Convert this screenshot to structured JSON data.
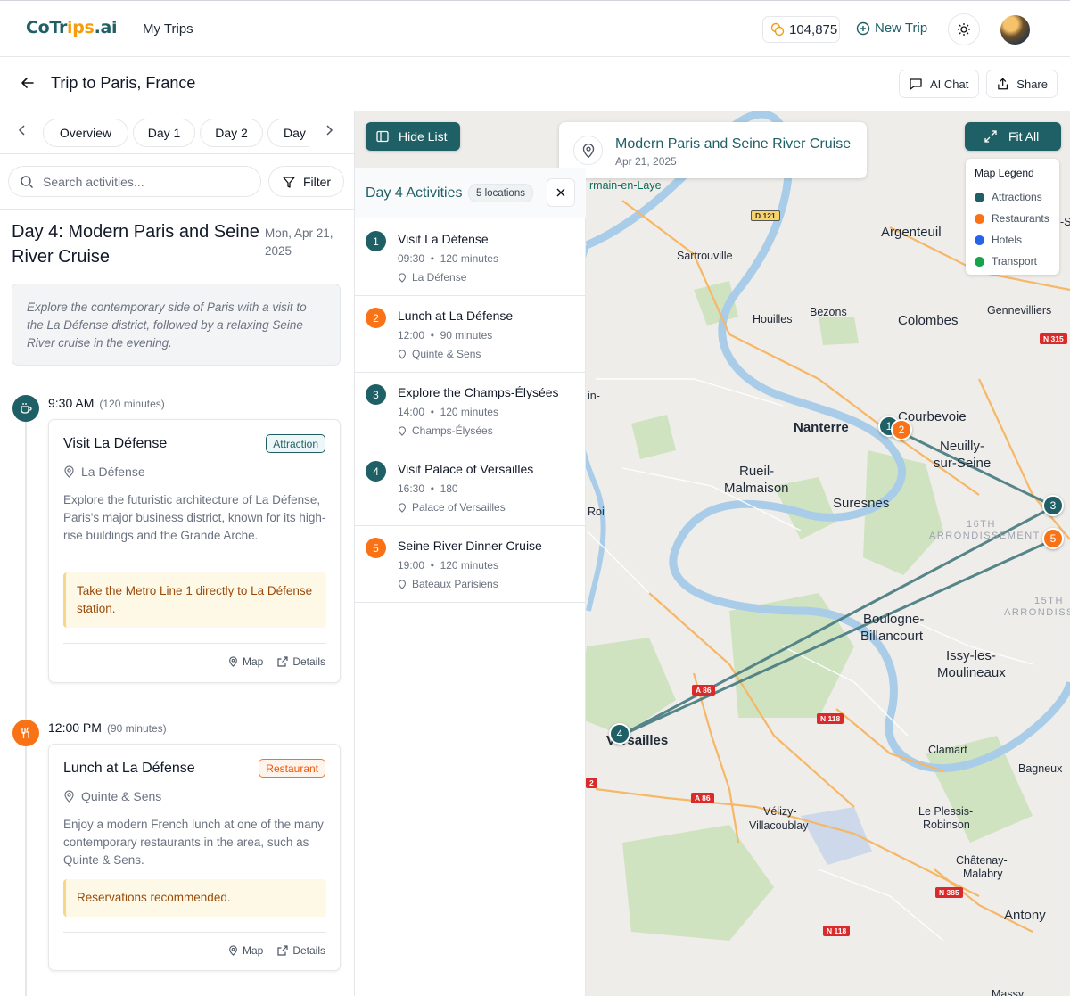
{
  "header": {
    "logo": {
      "part1": "CoTr",
      "part2": "ips",
      "part3": ".ai"
    },
    "nav_my_trips": "My Trips",
    "points": "104,875",
    "new_trip": "New Trip"
  },
  "trip": {
    "title": "Trip to Paris, France",
    "ai_chat": "AI Chat",
    "share": "Share"
  },
  "tabs": [
    "Overview",
    "Day 1",
    "Day 2",
    "Day"
  ],
  "search": {
    "placeholder": "Search activities...",
    "filter": "Filter"
  },
  "day": {
    "title": "Day 4: Modern Paris and Seine River Cruise",
    "date": "Mon, Apr 21, 2025",
    "description": "Explore the contemporary side of Paris with a visit to the La Défense district, followed by a relaxing Seine River cruise in the evening."
  },
  "timeline": [
    {
      "time": "9:30 AM",
      "duration": "(120 minutes)",
      "icon": "coffee-icon",
      "title": "Visit La Défense",
      "badge": "Attraction",
      "location": "La Défense",
      "description": "Explore the futuristic architecture of La Défense, Paris's major business district, known for its high-rise buildings and the Grande Arche.",
      "tip": "Take the Metro Line 1 directly to La Défense station.",
      "map_link": "Map",
      "details_link": "Details"
    },
    {
      "time": "12:00 PM",
      "duration": "(90 minutes)",
      "icon": "utensils-icon",
      "title": "Lunch at La Défense",
      "badge": "Restaurant",
      "location": "Quinte & Sens",
      "description": "Enjoy a modern French lunch at one of the many contemporary restaurants in the area, such as Quinte & Sens.",
      "tip": "Reservations recommended.",
      "map_link": "Map",
      "details_link": "Details"
    }
  ],
  "map": {
    "hide_list": "Hide List",
    "fit_all": "Fit All",
    "selected_title": "Modern Paris and Seine River Cruise",
    "selected_date": "Apr 21, 2025",
    "legend": {
      "title": "Map Legend",
      "items": [
        {
          "label": "Attractions",
          "color": "#1f5f66"
        },
        {
          "label": "Restaurants",
          "color": "#f97316"
        },
        {
          "label": "Hotels",
          "color": "#2563eb"
        },
        {
          "label": "Transport",
          "color": "#16a34a"
        }
      ]
    },
    "places": {
      "germain": "rmain-en-Laye",
      "sartrouville": "Sartrouville",
      "argenteuil": "Argenteuil",
      "houilles": "Houilles",
      "bezons": "Bezons",
      "colombes": "Colombes",
      "gennevilliers": "Gennevilliers",
      "gennevilliers2": "-S",
      "nanterre": "Nanterre",
      "courbevoie": "Courbevoie",
      "neuilly1": "Neuilly-",
      "neuilly2": "sur-Seine",
      "rueil1": "Rueil-",
      "rueil2": "Malmaison",
      "suresnes": "Suresnes",
      "arr16a": "16TH",
      "arr16b": "ARRONDISSEMENT",
      "arr15a": "15TH",
      "arr15b": "ARRONDISSEME",
      "boulogne1": "Boulogne-",
      "boulogne2": "Billancourt",
      "issy1": "Issy-les-",
      "issy2": "Moulineaux",
      "versailles": "Versailles",
      "clamart": "Clamart",
      "bagneux": "Bagneux",
      "velizy1": "Vélizy-",
      "velizy2": "Villacoublay",
      "plessis1": "Le Plessis-",
      "plessis2": "Robinson",
      "chatenay1": "Châtenay-",
      "chatenay2": "Malabry",
      "antony": "Antony",
      "in": "in-",
      "roi": "Roi",
      "massy": "Massy"
    },
    "roads": {
      "d121": "D 121",
      "n315": "N 315",
      "a86a": "A 86",
      "n118a": "N 118",
      "a86b": "A 86",
      "n385": "N 385",
      "n118b": "N 118",
      "r2": "2"
    }
  },
  "activities_panel": {
    "title": "Day 4 Activities",
    "count": "5 locations",
    "items": [
      {
        "num": "1",
        "title": "Visit La Défense",
        "time": "09:30",
        "duration": "120 minutes",
        "location": "La Défense",
        "color": "#1f5f66"
      },
      {
        "num": "2",
        "title": "Lunch at La Défense",
        "time": "12:00",
        "duration": "90 minutes",
        "location": "Quinte & Sens",
        "color": "#f97316"
      },
      {
        "num": "3",
        "title": "Explore the Champs-Élysées",
        "time": "14:00",
        "duration": "120 minutes",
        "location": "Champs-Élysées",
        "color": "#1f5f66"
      },
      {
        "num": "4",
        "title": "Visit Palace of Versailles",
        "time": "16:30",
        "duration": "180",
        "location": "Palace of Versailles",
        "color": "#1f5f66"
      },
      {
        "num": "5",
        "title": "Seine River Dinner Cruise",
        "time": "19:00",
        "duration": "120 minutes",
        "location": "Bateaux Parisiens",
        "color": "#f97316"
      }
    ]
  }
}
